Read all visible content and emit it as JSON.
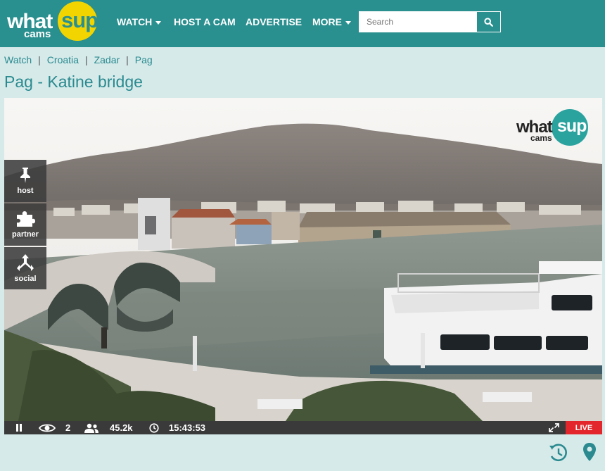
{
  "logo": {
    "what": "what",
    "sup": "sup",
    "cams": "cams"
  },
  "nav": {
    "watch": "WATCH",
    "host": "HOST A CAM",
    "advertise": "ADVERTISE",
    "more": "MORE"
  },
  "search": {
    "placeholder": "Search"
  },
  "breadcrumb": [
    "Watch",
    "Croatia",
    "Zadar",
    "Pag"
  ],
  "page_title": "Pag - Katine bridge",
  "side_panel": {
    "host": "host",
    "partner": "partner",
    "social": "social"
  },
  "cam_logo": {
    "what": "what",
    "sup": "sup",
    "cams": "cams"
  },
  "controls": {
    "viewers": "2",
    "total_views": "45.2k",
    "time": "15:43:53",
    "live": "LIVE"
  },
  "colors": {
    "header": "#2a8f8f",
    "page_bg": "#d6eaea",
    "logo_yellow": "#f2d500",
    "live_red": "#e2262b"
  }
}
